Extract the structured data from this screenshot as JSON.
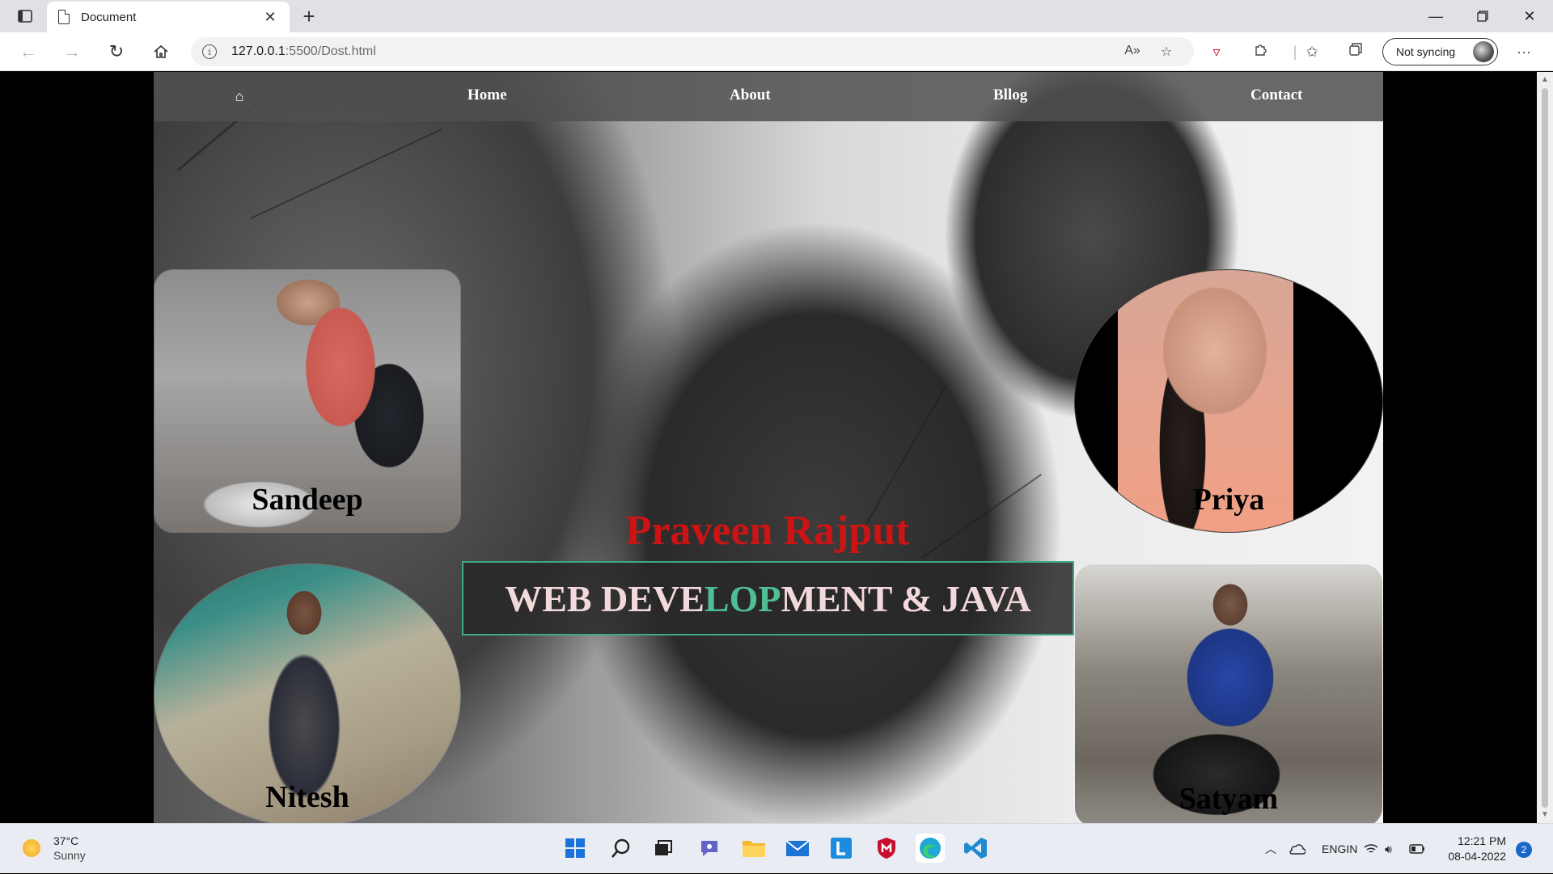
{
  "browser": {
    "tab_title": "Document",
    "new_tab_symbol": "+",
    "url_host": "127.0.0.1",
    "url_rest": ":5500/Dost.html",
    "sync_label": "Not syncing"
  },
  "site": {
    "nav": {
      "home": "Home",
      "about": "About",
      "blog": "Bllog",
      "contact": "Contact"
    },
    "cards": {
      "sandeep": "Sandeep",
      "priya": "Priya",
      "nitesh": "Nitesh",
      "satyam": "Satyam"
    },
    "hero_name": "Praveen Rajput",
    "tagline": {
      "part1": "WEB DEVE",
      "part2": "LOP",
      "part3": "MENT & JAVA"
    },
    "colors": {
      "hero_name": "#cc1414",
      "tagline_text": "#f2d9dc",
      "tagline_accent": "#4fbf93",
      "tagline_border": "#3ea88b"
    }
  },
  "taskbar": {
    "weather_temp": "37°C",
    "weather_cond": "Sunny",
    "lang_top": "ENG",
    "lang_bottom": "IN",
    "time": "12:21 PM",
    "date": "08-04-2022",
    "notification_count": "2",
    "apps": [
      "windows-start",
      "search",
      "task-view",
      "teams-chat",
      "file-explorer",
      "mail",
      "l-app",
      "mcafee",
      "edge",
      "vscode"
    ]
  }
}
